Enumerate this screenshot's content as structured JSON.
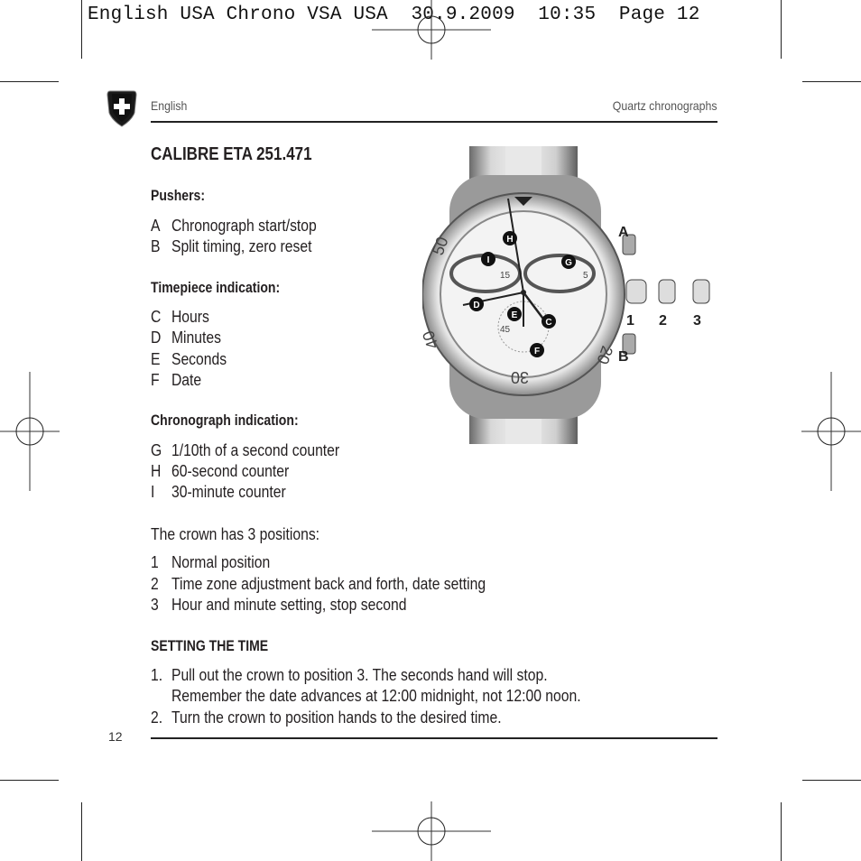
{
  "print_slug": "English USA Chrono VSA USA  30.9.2009  10:35  Page 12",
  "header": {
    "language": "English",
    "section": "Quartz chronographs",
    "logo": "victorinox-shield-cross-icon"
  },
  "title": "CALIBRE ETA 251.471",
  "pushers": {
    "heading": "Pushers:",
    "items": [
      {
        "key": "A",
        "label": "Chronograph start/stop"
      },
      {
        "key": "B",
        "label": "Split timing, zero reset"
      }
    ]
  },
  "timepiece": {
    "heading": "Timepiece indication:",
    "items": [
      {
        "key": "C",
        "label": "Hours"
      },
      {
        "key": "D",
        "label": "Minutes"
      },
      {
        "key": "E",
        "label": "Seconds"
      },
      {
        "key": "F",
        "label": "Date"
      }
    ]
  },
  "chronograph": {
    "heading": "Chronograph indication:",
    "items": [
      {
        "key": "G",
        "label": "1/10th of a second counter"
      },
      {
        "key": "H",
        "label": "60-second counter"
      },
      {
        "key": "I",
        "label": "30-minute counter"
      }
    ]
  },
  "crown": {
    "intro": "The crown has 3 positions:",
    "items": [
      {
        "key": "1",
        "label": "Normal position"
      },
      {
        "key": "2",
        "label": "Time zone adjustment back and forth, date setting"
      },
      {
        "key": "3",
        "label": "Hour and minute setting, stop second"
      }
    ]
  },
  "setting": {
    "heading": "SETTING THE TIME",
    "steps": [
      {
        "num": "1.",
        "lines": [
          "Pull out the crown to position 3. The seconds hand will stop.",
          "Remember the date advances at 12:00 midnight, not 12:00 noon."
        ]
      },
      {
        "num": "2.",
        "lines": [
          "Turn the crown to position hands to the desired time."
        ]
      }
    ]
  },
  "figure": {
    "callouts": [
      "A",
      "B",
      "C",
      "D",
      "E",
      "F",
      "G",
      "H",
      "I"
    ],
    "crown_positions": [
      "1",
      "2",
      "3"
    ],
    "bezel_numbers": [
      "50",
      "40",
      "30",
      "20"
    ],
    "subdial_numbers": [
      "15",
      "5",
      "45"
    ]
  },
  "footer": {
    "page_number": "12"
  }
}
